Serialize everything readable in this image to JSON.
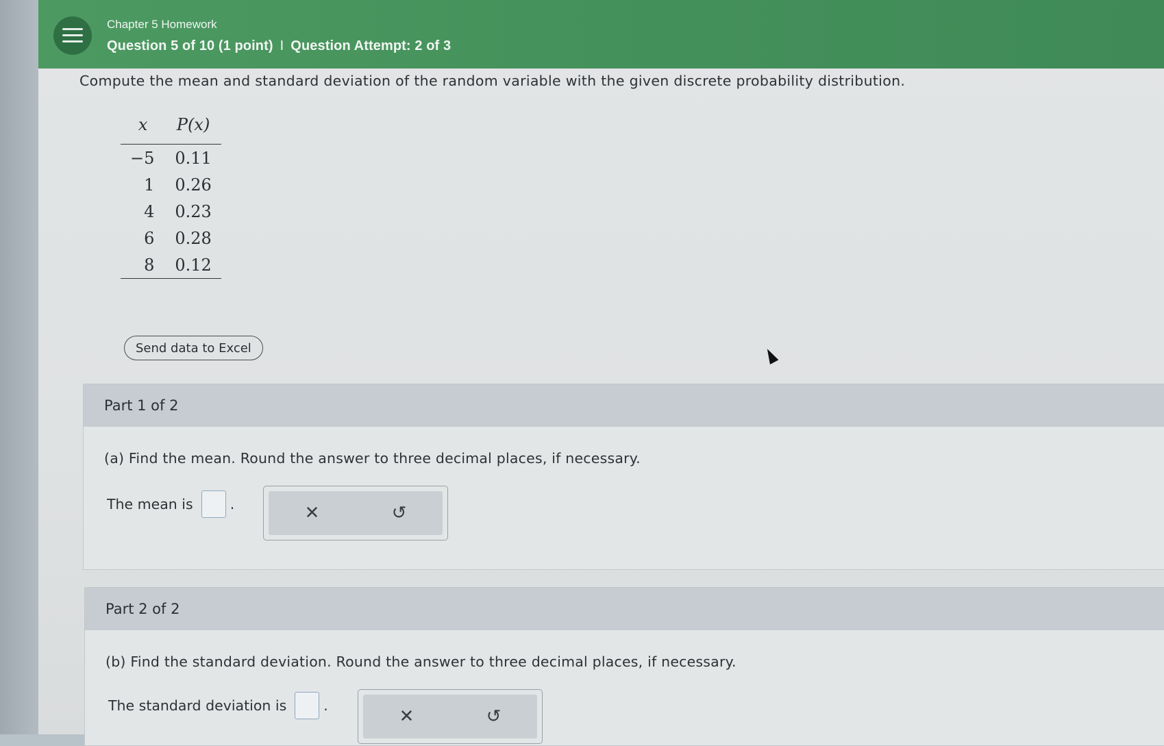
{
  "header": {
    "assignment_title": "Chapter 5 Homework",
    "question_info": "Question 5 of 10 (1 point)",
    "separator": "I",
    "attempt_info": "Question Attempt: 2 of 3"
  },
  "problem": {
    "prompt": "Compute the mean and standard deviation of the random variable with the given discrete probability distribution.",
    "table": {
      "col_x": "x",
      "col_p": "P(x)",
      "rows": [
        {
          "x": "−5",
          "p": "0.11"
        },
        {
          "x": "1",
          "p": "0.26"
        },
        {
          "x": "4",
          "p": "0.23"
        },
        {
          "x": "6",
          "p": "0.28"
        },
        {
          "x": "8",
          "p": "0.12"
        }
      ]
    },
    "excel_button": "Send data to Excel"
  },
  "part1": {
    "heading": "Part 1 of 2",
    "question": "(a) Find the mean. Round the answer to three decimal places, if necessary.",
    "answer_label": "The mean is",
    "answer_value": "",
    "period": ".",
    "clear_icon": "✕",
    "undo_icon": "↺"
  },
  "part2": {
    "heading": "Part 2 of 2",
    "question": "(b) Find the standard deviation. Round the answer to three decimal places, if necessary.",
    "answer_label": "The standard deviation is",
    "answer_value": "",
    "period": ".",
    "clear_icon": "✕",
    "undo_icon": "↺"
  },
  "colors": {
    "header_green": "#45915b",
    "menu_circle": "#2f6f44",
    "part_header": "#c6ccd1",
    "input_border": "#8fa7c0"
  }
}
